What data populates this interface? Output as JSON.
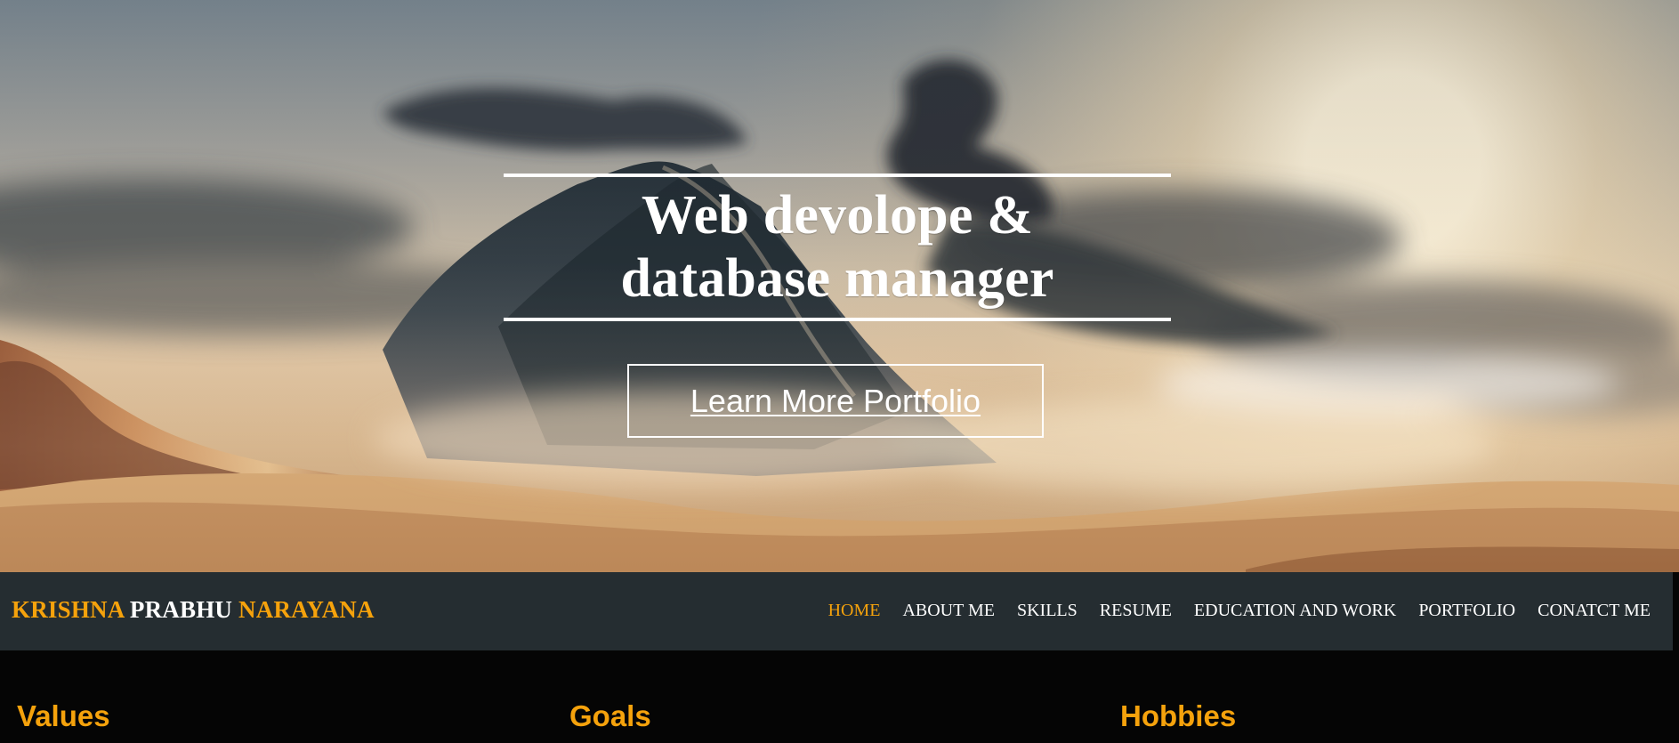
{
  "hero": {
    "headline": "Web devolope & database manager",
    "button_label": "Learn More Portfolio",
    "background_image": "mountain-cloud-sunset"
  },
  "navbar": {
    "brand": {
      "first": "KRISHNA",
      "middle": "PRABHU",
      "last": "NARAYANA"
    },
    "items": [
      {
        "label": "HOME",
        "active": true
      },
      {
        "label": "ABOUT ME",
        "active": false
      },
      {
        "label": "SKILLS",
        "active": false
      },
      {
        "label": "RESUME",
        "active": false
      },
      {
        "label": "EDUCATION AND WORK",
        "active": false
      },
      {
        "label": "PORTFOLIO",
        "active": false
      },
      {
        "label": "CONATCT ME",
        "active": false
      }
    ]
  },
  "sections": {
    "values": "Values",
    "goals": "Goals",
    "hobbies": "Hobbies"
  },
  "colors": {
    "accent": "#f5a20c",
    "navbar": "#252d31",
    "text": "#ffffff",
    "content_background": "#050505"
  }
}
